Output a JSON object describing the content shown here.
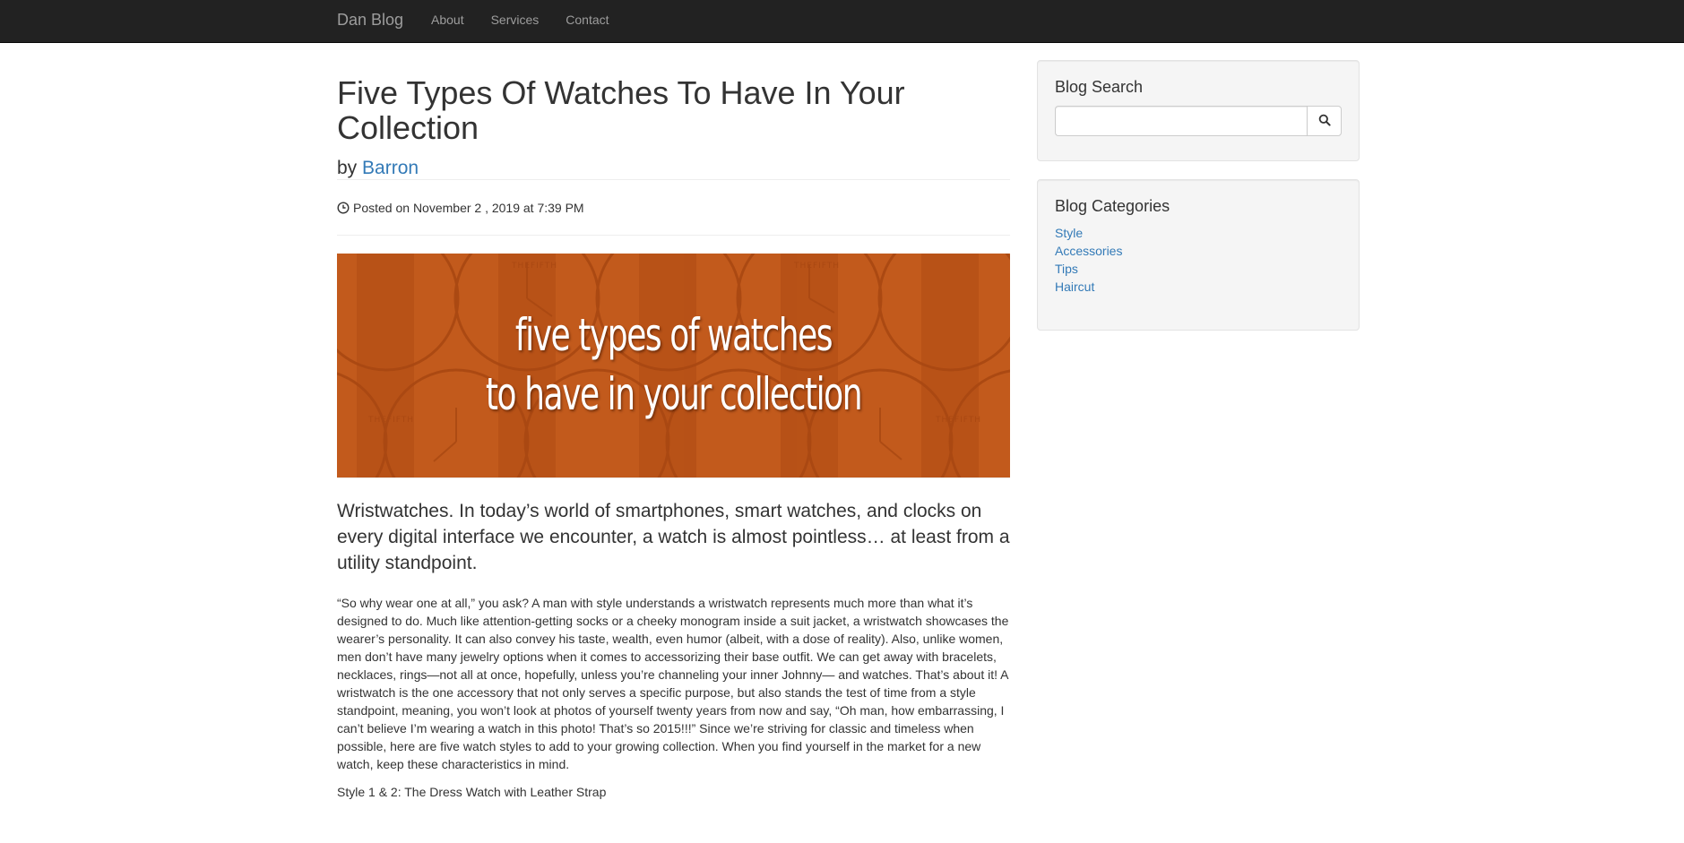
{
  "navbar": {
    "brand": "Dan Blog",
    "links": [
      {
        "label": "About"
      },
      {
        "label": "Services"
      },
      {
        "label": "Contact"
      }
    ]
  },
  "post": {
    "title": "Five Types Of Watches To Have In Your Collection",
    "by_label": "by",
    "author": "Barron",
    "posted": "Posted on November 2 , 2019 at 7:39 PM",
    "hero": {
      "line1": "five types of watches",
      "line2": "to have in your collection",
      "watermark": "THEFIFTH",
      "bg_color": "#c25a1c"
    },
    "lead": "Wristwatches. In today’s world of smartphones, smart watches, and clocks on every digital interface we encounter, a watch is almost pointless… at least from a utility standpoint.",
    "body": "“So why wear one at all,” you ask? A man with style understands a wristwatch represents much more than what it’s designed to do. Much like attention-getting socks or a cheeky monogram inside a suit jacket, a wristwatch showcases the wearer’s personality. It can also convey his taste, wealth, even humor (albeit, with a dose of reality). Also, unlike women, men don’t have many jewelry options when it comes to accessorizing their base outfit. We can get away with bracelets, necklaces, rings—not all at once, hopefully, unless you’re channeling your inner Johnny— and watches. That’s about it! A wristwatch is the one accessory that not only serves a specific purpose, but also stands the test of time from a style standpoint, meaning, you won’t look at photos of yourself twenty years from now and say, “Oh man, how embarrassing, I can’t believe I’m wearing a watch in this photo! That’s so 2015!!!” Since we’re striving for classic and timeless when possible, here are five watch styles to add to your growing collection. When you find yourself in the market for a new watch, keep these characteristics in mind.",
    "subheading": "Style 1 & 2: The Dress Watch with Leather Strap"
  },
  "sidebar": {
    "search": {
      "title": "Blog Search",
      "value": "",
      "placeholder": ""
    },
    "categories": {
      "title": "Blog Categories",
      "items": [
        {
          "label": "Style"
        },
        {
          "label": "Accessories"
        },
        {
          "label": "Tips"
        },
        {
          "label": "Haircut"
        }
      ]
    }
  },
  "colors": {
    "navbar_bg": "#222222",
    "link": "#337ab7",
    "well_bg": "#f5f5f5"
  }
}
